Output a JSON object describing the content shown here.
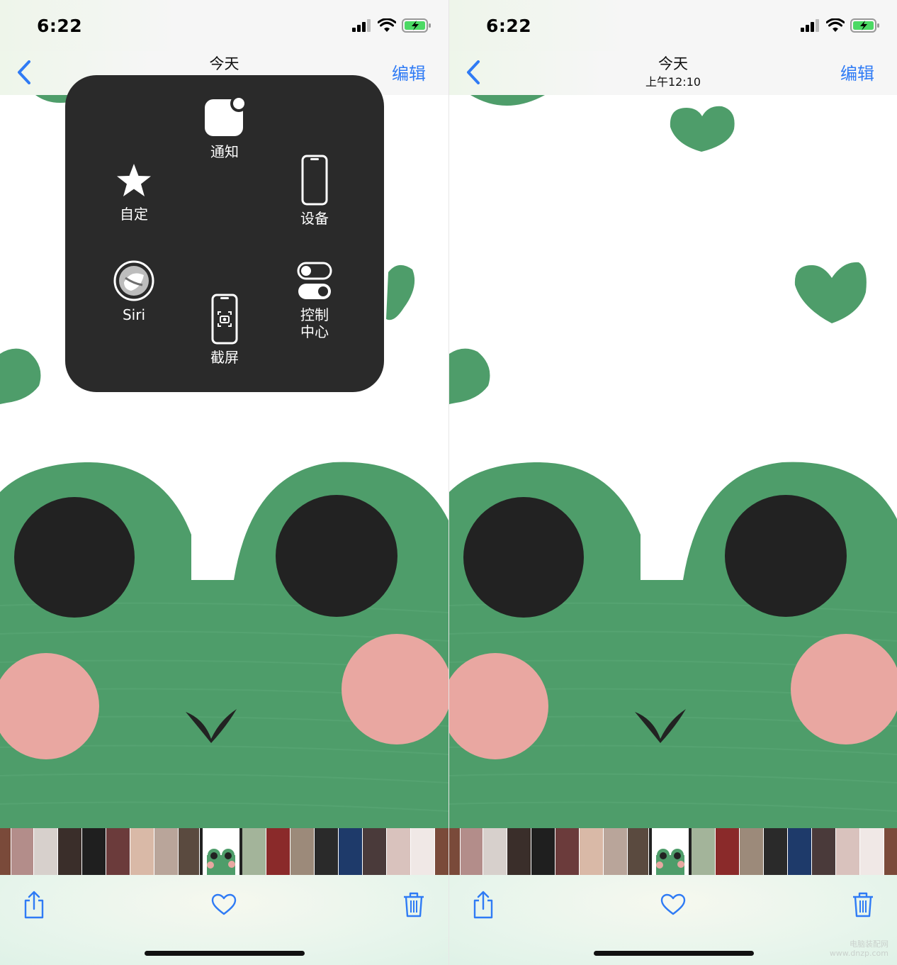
{
  "status": {
    "time": "6:22"
  },
  "left": {
    "nav": {
      "title": "今天",
      "subtitle": "",
      "edit_label": "编辑"
    },
    "assistive_menu": {
      "items": {
        "notifications": "通知",
        "custom": "自定",
        "device": "设备",
        "siri": "Siri",
        "screenshot": "截屏",
        "control_center_line1": "控制",
        "control_center_line2": "中心"
      }
    }
  },
  "right": {
    "nav": {
      "title": "今天",
      "subtitle": "上午12:10",
      "edit_label": "编辑"
    }
  },
  "watermark": {
    "line1": "电脑装配网",
    "line2": "www.dnzp.com"
  },
  "colors": {
    "accent": "#2f7bf5",
    "frog_green": "#4e9d6a",
    "cheek_pink": "#e9a7a1",
    "eye_black": "#222222",
    "menu_bg": "#2a2a2a"
  }
}
